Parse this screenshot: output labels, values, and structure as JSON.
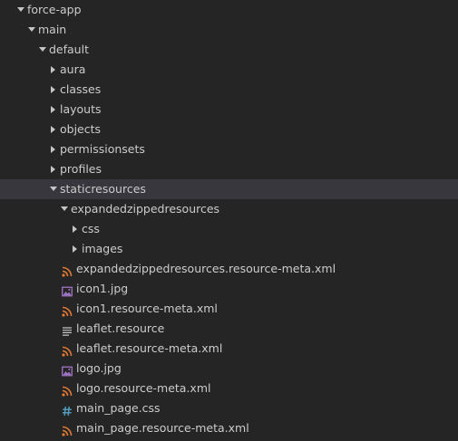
{
  "explorer": {
    "items": [
      {
        "label": "force-app",
        "type": "folder",
        "expanded": true,
        "depth": 0
      },
      {
        "label": "main",
        "type": "folder",
        "expanded": true,
        "depth": 1
      },
      {
        "label": "default",
        "type": "folder",
        "expanded": true,
        "depth": 2
      },
      {
        "label": "aura",
        "type": "folder",
        "expanded": false,
        "depth": 3
      },
      {
        "label": "classes",
        "type": "folder",
        "expanded": false,
        "depth": 3
      },
      {
        "label": "layouts",
        "type": "folder",
        "expanded": false,
        "depth": 3
      },
      {
        "label": "objects",
        "type": "folder",
        "expanded": false,
        "depth": 3
      },
      {
        "label": "permissionsets",
        "type": "folder",
        "expanded": false,
        "depth": 3
      },
      {
        "label": "profiles",
        "type": "folder",
        "expanded": false,
        "depth": 3
      },
      {
        "label": "staticresources",
        "type": "folder",
        "expanded": true,
        "depth": 3,
        "selected": true
      },
      {
        "label": "expandedzippedresources",
        "type": "folder",
        "expanded": true,
        "depth": 4
      },
      {
        "label": "css",
        "type": "folder",
        "expanded": false,
        "depth": 5
      },
      {
        "label": "images",
        "type": "folder",
        "expanded": false,
        "depth": 5
      },
      {
        "label": "expandedzippedresources.resource-meta.xml",
        "type": "file",
        "icon": "rss-icon",
        "depth": 4
      },
      {
        "label": "icon1.jpg",
        "type": "file",
        "icon": "image-icon",
        "depth": 4
      },
      {
        "label": "icon1.resource-meta.xml",
        "type": "file",
        "icon": "rss-icon",
        "depth": 4
      },
      {
        "label": "leaflet.resource",
        "type": "file",
        "icon": "lines-icon",
        "depth": 4
      },
      {
        "label": "leaflet.resource-meta.xml",
        "type": "file",
        "icon": "rss-icon",
        "depth": 4
      },
      {
        "label": "logo.jpg",
        "type": "file",
        "icon": "image-icon",
        "depth": 4
      },
      {
        "label": "logo.resource-meta.xml",
        "type": "file",
        "icon": "rss-icon",
        "depth": 4
      },
      {
        "label": "main_page.css",
        "type": "file",
        "icon": "hash-icon",
        "depth": 4
      },
      {
        "label": "main_page.resource-meta.xml",
        "type": "file",
        "icon": "rss-icon",
        "depth": 4
      }
    ]
  },
  "colors": {
    "background": "#252526",
    "selection": "#37373d",
    "text": "#cccccc",
    "rss": "#e37933",
    "image": "#a074c4",
    "css_hash": "#519aba",
    "lines": "#c5c5c5"
  }
}
